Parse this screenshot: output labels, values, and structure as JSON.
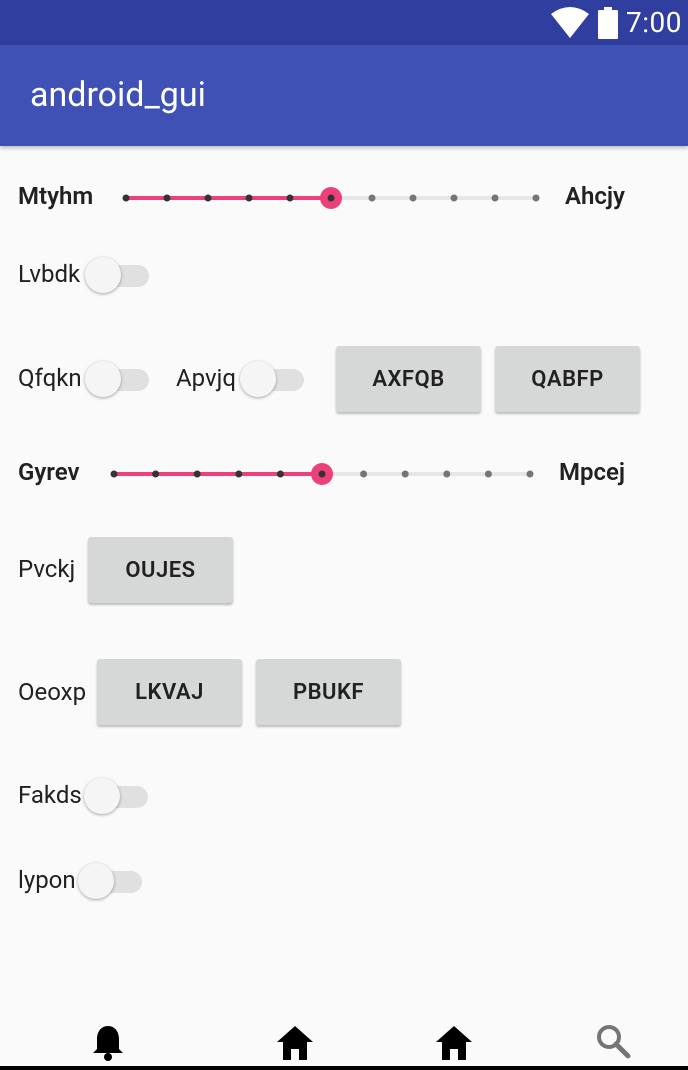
{
  "status_bar": {
    "time": "7:00"
  },
  "app_bar": {
    "title": "android_gui"
  },
  "rows": {
    "slider1": {
      "left_label": "Mtyhm",
      "right_label": "Ahcjy",
      "value": 5,
      "max": 10
    },
    "switch1": {
      "label": "Lvbdk",
      "checked": false
    },
    "row3": {
      "switch_a_label": "Qfqkn",
      "switch_b_label": "Apvjq",
      "button1_label": "AXFQB",
      "button2_label": "QABFP"
    },
    "slider2": {
      "left_label": "Gyrev",
      "right_label": "Mpcej",
      "value": 5,
      "max": 10
    },
    "row5": {
      "label": "Pvckj",
      "button_label": "OUJES"
    },
    "row6": {
      "label": "Oeoxp",
      "button1_label": "LKVAJ",
      "button2_label": "PBUKF"
    },
    "switch2": {
      "label": "Fakds",
      "checked": false
    },
    "switch3": {
      "label": "lypon",
      "checked": false
    }
  },
  "bottom_nav": {
    "items": [
      {
        "icon": "bell-icon"
      },
      {
        "icon": "home-icon"
      },
      {
        "icon": "home-icon"
      },
      {
        "icon": "search-icon"
      }
    ]
  },
  "colors": {
    "status_bar": "#303f9f",
    "app_bar": "#3f51b5",
    "accent": "#ec407a",
    "button": "#d6d7d7"
  }
}
